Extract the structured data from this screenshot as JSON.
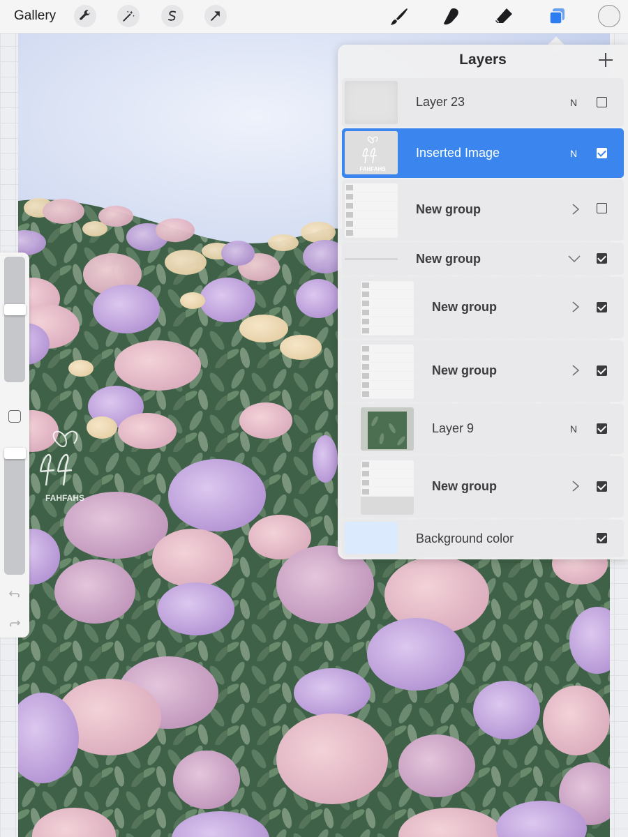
{
  "topbar": {
    "gallery_label": "Gallery",
    "tools": [
      {
        "name": "wrench-icon"
      },
      {
        "name": "magic-wand-icon"
      },
      {
        "name": "selection-icon"
      },
      {
        "name": "transform-arrow-icon"
      }
    ],
    "paint_tools": [
      {
        "name": "brush-icon"
      },
      {
        "name": "smudge-icon"
      },
      {
        "name": "eraser-icon"
      },
      {
        "name": "layers-icon",
        "active": true
      }
    ],
    "accent_color": "#2d7cf0"
  },
  "canvas": {
    "watermark_text": "FAHFAHS",
    "sky_color": "#c9d3ec",
    "foliage_color": "#476a4f"
  },
  "layers_panel": {
    "title": "Layers",
    "layers": [
      {
        "name": "Layer 23",
        "mode": "N",
        "visible": false,
        "type": "layer",
        "selected": false
      },
      {
        "name": "Inserted Image",
        "mode": "N",
        "visible": true,
        "type": "layer",
        "selected": true
      },
      {
        "name": "New group",
        "mode": "",
        "visible": false,
        "type": "group",
        "expanded": false
      },
      {
        "name": "New group",
        "mode": "",
        "visible": true,
        "type": "group",
        "expanded": true
      },
      {
        "name": "New group",
        "mode": "",
        "visible": true,
        "type": "group",
        "expanded": false,
        "nested": true
      },
      {
        "name": "New group",
        "mode": "",
        "visible": true,
        "type": "group",
        "expanded": false,
        "nested": true
      },
      {
        "name": "Layer 9",
        "mode": "N",
        "visible": true,
        "type": "layer",
        "nested": true
      },
      {
        "name": "New group",
        "mode": "",
        "visible": true,
        "type": "group",
        "expanded": false,
        "nested": true
      },
      {
        "name": "Background color",
        "mode": "",
        "visible": true,
        "type": "background"
      }
    ]
  }
}
